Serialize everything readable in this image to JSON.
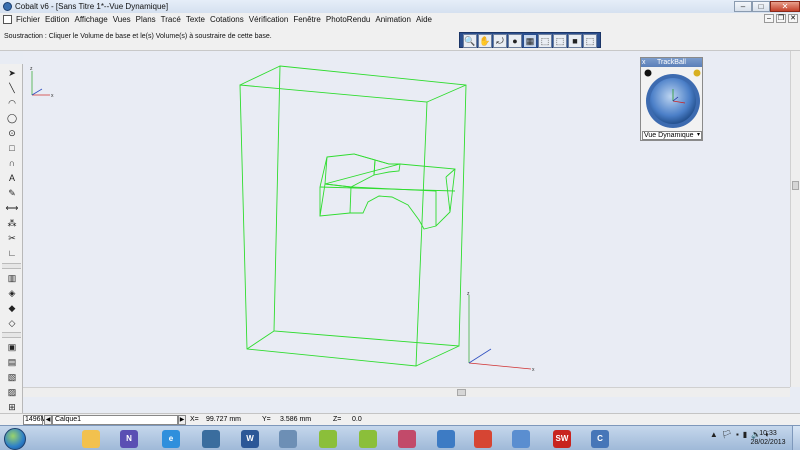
{
  "window": {
    "title": "Cobalt v6 - [Sans Titre 1*--Vue Dynamique]",
    "controls": {
      "minimize": "–",
      "maximize": "□",
      "close": "✕"
    }
  },
  "menu": {
    "items": [
      "Fichier",
      "Edition",
      "Affichage",
      "Vues",
      "Plans",
      "Tracé",
      "Texte",
      "Cotations",
      "Vérification",
      "Fenêtre",
      "PhotoRendu",
      "Animation",
      "Aide"
    ],
    "mdi_controls": {
      "minimize": "–",
      "restore": "❐",
      "close": "✕"
    }
  },
  "prompt": {
    "text": "Soustraction : Cliquer le Volume de base et le(s) Volume(s) à soustraire de cette base."
  },
  "view_toolbar": {
    "icons": [
      "zoom-icon",
      "pan-hand-icon",
      "orbit-icon",
      "sphere-icon",
      "cube-wireframe-icon",
      "cube-front-icon",
      "cube-shaded-icon",
      "cube-solid-icon",
      "cube-right-icon"
    ],
    "glyphs": [
      "🔍",
      "✋",
      "⤾",
      "●",
      "▦",
      "⬚",
      "⬚",
      "■",
      "⬚"
    ]
  },
  "trackball": {
    "title": "TrackBall",
    "close": "x",
    "mode": "Vue Dynamique",
    "arrow": "▾"
  },
  "scene": {
    "axis_labels": {
      "z": "z",
      "x": "x"
    }
  },
  "coords": {
    "memory": "1496M",
    "layer": "Calque1",
    "x_label": "X=",
    "x_value": "99.727 mm",
    "y_label": "Y=",
    "y_value": "3.586 mm",
    "z_label": "Z=",
    "z_value": "0.0"
  },
  "taskbar": {
    "apps": [
      {
        "name": "explorer-icon",
        "color": "#f2c14e",
        "glyph": ""
      },
      {
        "name": "nvu-icon",
        "color": "#5a4fb3",
        "glyph": "N"
      },
      {
        "name": "ie-icon",
        "color": "#2f8fdc",
        "glyph": "e"
      },
      {
        "name": "network-icon",
        "color": "#3a6d9e",
        "glyph": ""
      },
      {
        "name": "word-icon",
        "color": "#2b5797",
        "glyph": "W"
      },
      {
        "name": "calculator-icon",
        "color": "#6d8fb5",
        "glyph": ""
      },
      {
        "name": "chat-icon",
        "color": "#8bbf3a",
        "glyph": ""
      },
      {
        "name": "chat2-icon",
        "color": "#8bbf3a",
        "glyph": ""
      },
      {
        "name": "tools-icon",
        "color": "#c24a6a",
        "glyph": ""
      },
      {
        "name": "monitor-icon",
        "color": "#3d7bc4",
        "glyph": ""
      },
      {
        "name": "chrome-icon",
        "color": "#d64533",
        "glyph": ""
      },
      {
        "name": "network-share-icon",
        "color": "#5a8ed0",
        "glyph": ""
      },
      {
        "name": "solidworks-icon",
        "color": "#c8241f",
        "glyph": "SW"
      },
      {
        "name": "cobalt-icon",
        "color": "#4676b8",
        "glyph": "C"
      }
    ],
    "tray": [
      "▲",
      "🏳",
      "▪",
      "▮",
      "🔊",
      "◐"
    ],
    "time": "10:33",
    "date": "28/02/2013"
  }
}
